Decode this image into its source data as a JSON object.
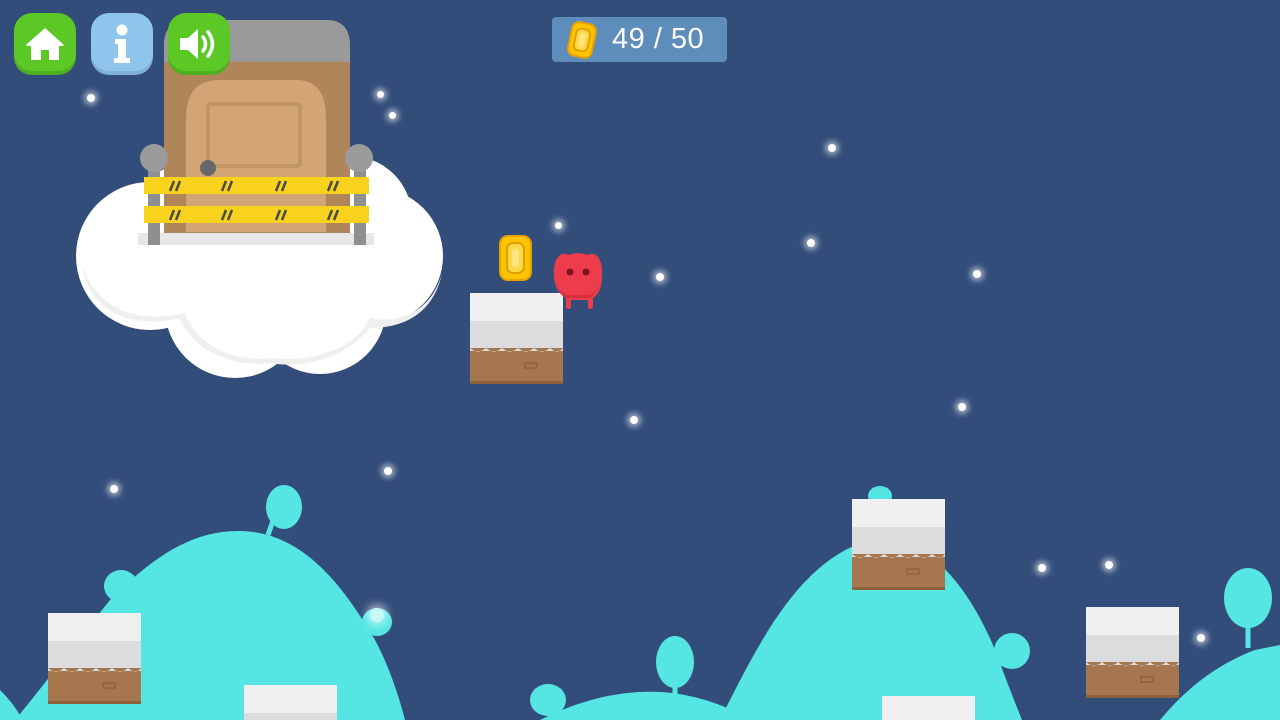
{
  "hud": {
    "coins_collected": 49,
    "coins_total": 50,
    "coin_counter_text": "49 / 50"
  },
  "buttons": {
    "home": "home-icon",
    "info": "info-icon",
    "sound": "speaker-icon"
  },
  "colors": {
    "sky": "#334d7a",
    "hills": "#55e6e3",
    "button_green": "#5bc825",
    "button_blue": "#8fc5ec",
    "coin": "#ffc400",
    "player": "#ee3d4a",
    "counter_bg": "#5f8dbb"
  },
  "icons": {
    "coin": "coin-icon"
  }
}
